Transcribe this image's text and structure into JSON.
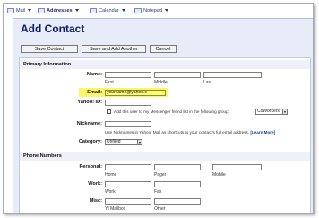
{
  "tabs": [
    {
      "label": "Mail",
      "icon": "mail-icon"
    },
    {
      "label": "Addresses",
      "icon": "addresses-icon"
    },
    {
      "label": "Calendar",
      "icon": "calendar-icon"
    },
    {
      "label": "Notepad",
      "icon": "notepad-icon"
    }
  ],
  "page": {
    "title": "Add Contact"
  },
  "buttons": {
    "save": "Save Contact",
    "save_add": "Save and Add Another",
    "cancel": "Cancel"
  },
  "primary": {
    "section": "Primary Information",
    "name_label": "Name:",
    "first": "First",
    "middle": "Middle",
    "last": "Last",
    "email_label": "Email:",
    "email_value": "yourname@yahoo.c",
    "yahoo_label": "Yahoo! ID:",
    "messenger_text": "Add this user to my Messenger friend list in the following group:",
    "group_value": "CoWorkers",
    "nickname_label": "Nickname:",
    "nickname_help": "Use Nicknames in Yahoo! Mail as shortcuts to your contact's full email address.",
    "learn_more": "[Learn More]",
    "category_label": "Category:",
    "category_value": "Unfiled"
  },
  "phones": {
    "section": "Phone Numbers",
    "personal_label": "Personal:",
    "home": "Home",
    "pager": "Pager",
    "mobile": "Mobile",
    "work_label": "Work:",
    "work": "Work",
    "fax": "Fax",
    "misc_label": "Misc:",
    "yi_mailbox": "YI Mailbox",
    "other": "Other"
  },
  "colors": {
    "accent": "#0d1c6b",
    "highlight": "#fbf56a",
    "panel": "#e7ecf8"
  }
}
